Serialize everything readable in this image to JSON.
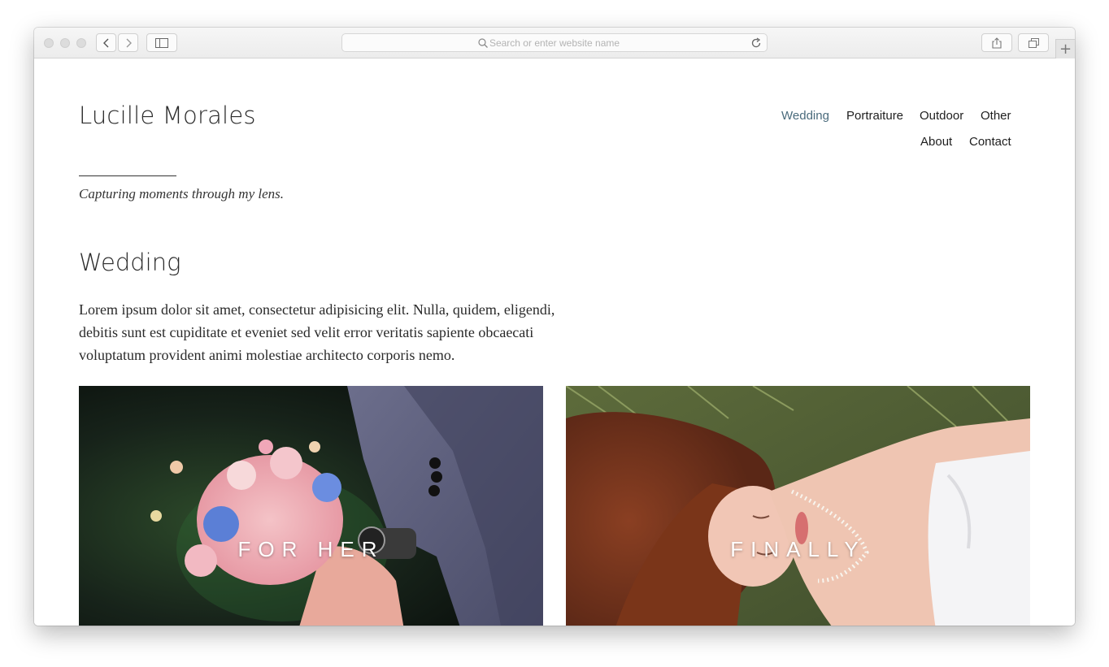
{
  "browser": {
    "address_placeholder": "Search or enter website name",
    "new_tab_label": "+"
  },
  "site": {
    "title": "Lucille Morales",
    "tagline": "Capturing moments through my lens."
  },
  "nav": {
    "items": [
      {
        "label": "Wedding",
        "active": true
      },
      {
        "label": "Portraiture",
        "active": false
      },
      {
        "label": "Outdoor",
        "active": false
      },
      {
        "label": "Other",
        "active": false
      },
      {
        "label": "About",
        "active": false
      },
      {
        "label": "Contact",
        "active": false
      }
    ]
  },
  "page": {
    "heading": "Wedding",
    "intro": "Lorem ipsum dolor sit amet, consectetur adipisicing elit. Nulla, quidem, eligendi, debitis sunt est cupiditate et eveniet sed velit error veritatis sapiente obcaecati voluptatum provident animi molestiae architecto corporis nemo."
  },
  "gallery": [
    {
      "label": "FOR HER",
      "icon": "bouquet-photo"
    },
    {
      "label": "FINALLY",
      "icon": "bride-photo"
    }
  ],
  "colors": {
    "active_nav": "#4a6b7c",
    "text": "#2b2b2b"
  }
}
